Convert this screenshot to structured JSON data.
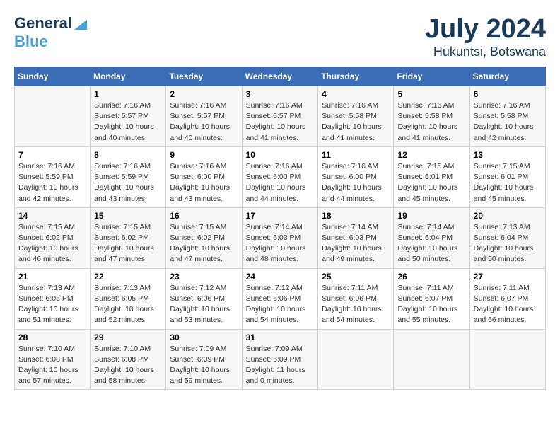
{
  "logo": {
    "line1": "General",
    "line2": "Blue"
  },
  "title": "July 2024",
  "subtitle": "Hukuntsi, Botswana",
  "days_header": [
    "Sunday",
    "Monday",
    "Tuesday",
    "Wednesday",
    "Thursday",
    "Friday",
    "Saturday"
  ],
  "weeks": [
    [
      {
        "num": "",
        "info": ""
      },
      {
        "num": "1",
        "info": "Sunrise: 7:16 AM\nSunset: 5:57 PM\nDaylight: 10 hours\nand 40 minutes."
      },
      {
        "num": "2",
        "info": "Sunrise: 7:16 AM\nSunset: 5:57 PM\nDaylight: 10 hours\nand 40 minutes."
      },
      {
        "num": "3",
        "info": "Sunrise: 7:16 AM\nSunset: 5:57 PM\nDaylight: 10 hours\nand 41 minutes."
      },
      {
        "num": "4",
        "info": "Sunrise: 7:16 AM\nSunset: 5:58 PM\nDaylight: 10 hours\nand 41 minutes."
      },
      {
        "num": "5",
        "info": "Sunrise: 7:16 AM\nSunset: 5:58 PM\nDaylight: 10 hours\nand 41 minutes."
      },
      {
        "num": "6",
        "info": "Sunrise: 7:16 AM\nSunset: 5:58 PM\nDaylight: 10 hours\nand 42 minutes."
      }
    ],
    [
      {
        "num": "7",
        "info": "Sunrise: 7:16 AM\nSunset: 5:59 PM\nDaylight: 10 hours\nand 42 minutes."
      },
      {
        "num": "8",
        "info": "Sunrise: 7:16 AM\nSunset: 5:59 PM\nDaylight: 10 hours\nand 43 minutes."
      },
      {
        "num": "9",
        "info": "Sunrise: 7:16 AM\nSunset: 6:00 PM\nDaylight: 10 hours\nand 43 minutes."
      },
      {
        "num": "10",
        "info": "Sunrise: 7:16 AM\nSunset: 6:00 PM\nDaylight: 10 hours\nand 44 minutes."
      },
      {
        "num": "11",
        "info": "Sunrise: 7:16 AM\nSunset: 6:00 PM\nDaylight: 10 hours\nand 44 minutes."
      },
      {
        "num": "12",
        "info": "Sunrise: 7:15 AM\nSunset: 6:01 PM\nDaylight: 10 hours\nand 45 minutes."
      },
      {
        "num": "13",
        "info": "Sunrise: 7:15 AM\nSunset: 6:01 PM\nDaylight: 10 hours\nand 45 minutes."
      }
    ],
    [
      {
        "num": "14",
        "info": "Sunrise: 7:15 AM\nSunset: 6:02 PM\nDaylight: 10 hours\nand 46 minutes."
      },
      {
        "num": "15",
        "info": "Sunrise: 7:15 AM\nSunset: 6:02 PM\nDaylight: 10 hours\nand 47 minutes."
      },
      {
        "num": "16",
        "info": "Sunrise: 7:15 AM\nSunset: 6:02 PM\nDaylight: 10 hours\nand 47 minutes."
      },
      {
        "num": "17",
        "info": "Sunrise: 7:14 AM\nSunset: 6:03 PM\nDaylight: 10 hours\nand 48 minutes."
      },
      {
        "num": "18",
        "info": "Sunrise: 7:14 AM\nSunset: 6:03 PM\nDaylight: 10 hours\nand 49 minutes."
      },
      {
        "num": "19",
        "info": "Sunrise: 7:14 AM\nSunset: 6:04 PM\nDaylight: 10 hours\nand 50 minutes."
      },
      {
        "num": "20",
        "info": "Sunrise: 7:13 AM\nSunset: 6:04 PM\nDaylight: 10 hours\nand 50 minutes."
      }
    ],
    [
      {
        "num": "21",
        "info": "Sunrise: 7:13 AM\nSunset: 6:05 PM\nDaylight: 10 hours\nand 51 minutes."
      },
      {
        "num": "22",
        "info": "Sunrise: 7:13 AM\nSunset: 6:05 PM\nDaylight: 10 hours\nand 52 minutes."
      },
      {
        "num": "23",
        "info": "Sunrise: 7:12 AM\nSunset: 6:06 PM\nDaylight: 10 hours\nand 53 minutes."
      },
      {
        "num": "24",
        "info": "Sunrise: 7:12 AM\nSunset: 6:06 PM\nDaylight: 10 hours\nand 54 minutes."
      },
      {
        "num": "25",
        "info": "Sunrise: 7:11 AM\nSunset: 6:06 PM\nDaylight: 10 hours\nand 54 minutes."
      },
      {
        "num": "26",
        "info": "Sunrise: 7:11 AM\nSunset: 6:07 PM\nDaylight: 10 hours\nand 55 minutes."
      },
      {
        "num": "27",
        "info": "Sunrise: 7:11 AM\nSunset: 6:07 PM\nDaylight: 10 hours\nand 56 minutes."
      }
    ],
    [
      {
        "num": "28",
        "info": "Sunrise: 7:10 AM\nSunset: 6:08 PM\nDaylight: 10 hours\nand 57 minutes."
      },
      {
        "num": "29",
        "info": "Sunrise: 7:10 AM\nSunset: 6:08 PM\nDaylight: 10 hours\nand 58 minutes."
      },
      {
        "num": "30",
        "info": "Sunrise: 7:09 AM\nSunset: 6:09 PM\nDaylight: 10 hours\nand 59 minutes."
      },
      {
        "num": "31",
        "info": "Sunrise: 7:09 AM\nSunset: 6:09 PM\nDaylight: 11 hours\nand 0 minutes."
      },
      {
        "num": "",
        "info": ""
      },
      {
        "num": "",
        "info": ""
      },
      {
        "num": "",
        "info": ""
      }
    ]
  ]
}
